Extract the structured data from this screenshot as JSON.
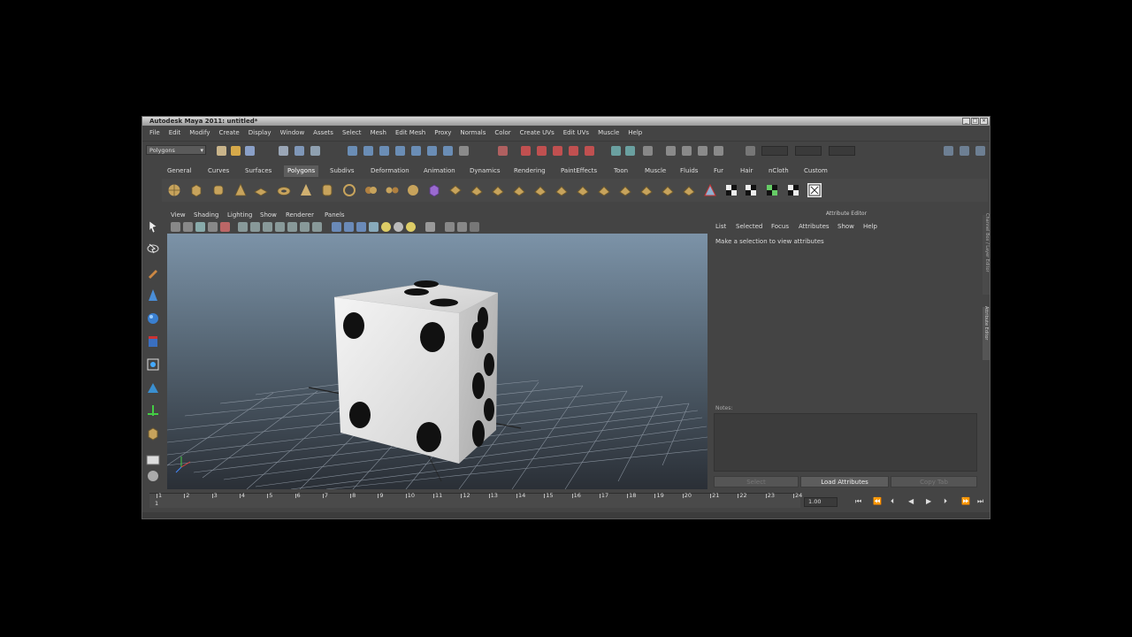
{
  "window": {
    "title": "Autodesk Maya 2011: untitled*"
  },
  "menubar": [
    "File",
    "Edit",
    "Modify",
    "Create",
    "Display",
    "Window",
    "Assets",
    "Select",
    "Mesh",
    "Edit Mesh",
    "Proxy",
    "Normals",
    "Color",
    "Create UVs",
    "Edit UVs",
    "Muscle",
    "Help"
  ],
  "status": {
    "mode": "Polygons"
  },
  "shelf_tabs": [
    "General",
    "Curves",
    "Surfaces",
    "Polygons",
    "Subdivs",
    "Deformation",
    "Animation",
    "Dynamics",
    "Rendering",
    "PaintEffects",
    "Toon",
    "Muscle",
    "Fluids",
    "Fur",
    "Hair",
    "nCloth",
    "Custom"
  ],
  "shelf_active": "Polygons",
  "viewport": {
    "menus": [
      "View",
      "Shading",
      "Lighting",
      "Show",
      "Renderer",
      "Panels"
    ]
  },
  "attribute_editor": {
    "title": "Attribute Editor",
    "menus": [
      "List",
      "Selected",
      "Focus",
      "Attributes",
      "Show",
      "Help"
    ],
    "message": "Make a selection to view attributes",
    "notes_label": "Notes:",
    "buttons": {
      "select": "Select",
      "load": "Load Attributes",
      "copy": "Copy Tab"
    }
  },
  "side_tabs": {
    "channel": "Channel Box / Layer Editor",
    "attribute": "Attribute Editor"
  },
  "timeline": {
    "ticks": [
      "1",
      "2",
      "3",
      "4",
      "5",
      "6",
      "7",
      "8",
      "9",
      "10",
      "11",
      "12",
      "13",
      "14",
      "15",
      "16",
      "17",
      "18",
      "19",
      "20",
      "21",
      "22",
      "23",
      "24"
    ],
    "current_frame": "1",
    "frame_field": "1.00"
  },
  "colors": {
    "shelf_active": "#5d5d5d",
    "viewport_top": "#7c93a8",
    "viewport_bottom": "#2a2f36"
  }
}
